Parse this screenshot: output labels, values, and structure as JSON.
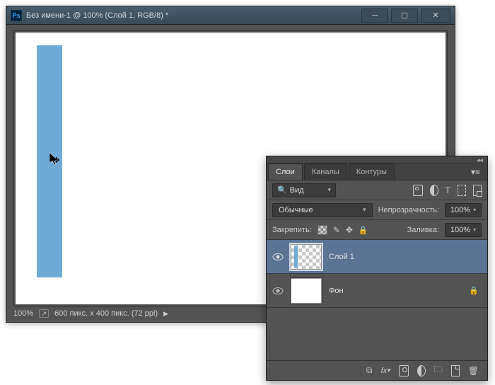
{
  "window": {
    "title": "Без имени-1 @ 100% (Слой 1, RGB/8) *"
  },
  "status": {
    "zoom": "100%",
    "info": "600 пикс. x 400 пикс. (72 ppi)"
  },
  "panel": {
    "tabs": {
      "layers": "Слои",
      "channels": "Каналы",
      "paths": "Контуры"
    },
    "filter_label": "Вид",
    "blend_mode": "Обычные",
    "opacity_label": "Непрозрачность:",
    "opacity_value": "100%",
    "lock_label": "Закрепить:",
    "fill_label": "Заливка:",
    "fill_value": "100%",
    "layers": [
      {
        "name": "Слой 1",
        "visible": true,
        "selected": true,
        "locked": false,
        "thumb": "trans"
      },
      {
        "name": "Фон",
        "visible": true,
        "selected": false,
        "locked": true,
        "thumb": "white"
      }
    ]
  }
}
